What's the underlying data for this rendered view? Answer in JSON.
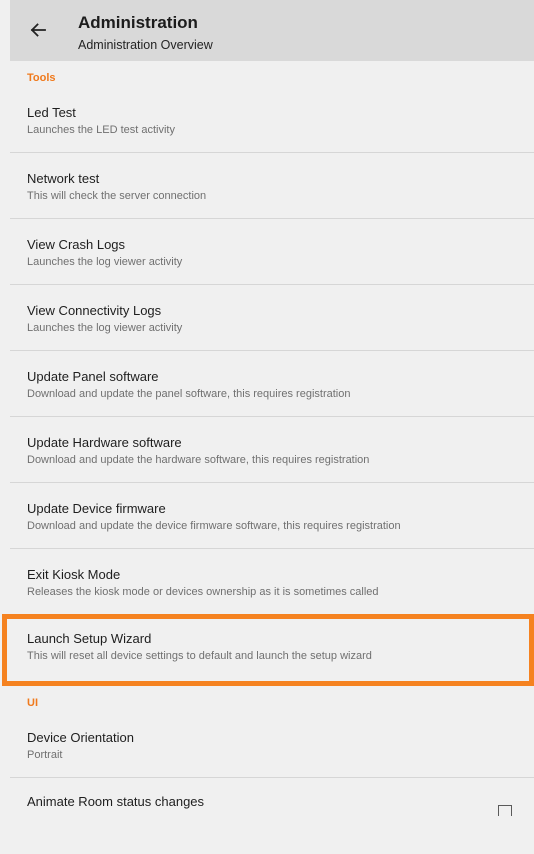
{
  "appbar": {
    "title": "Administration",
    "subtitle": "Administration Overview",
    "back_icon": "arrow-left-icon"
  },
  "categories": {
    "tools": "Tools",
    "ui": "UI"
  },
  "tools": [
    {
      "title": "Led Test",
      "summary": "Launches the LED test activity"
    },
    {
      "title": "Network test",
      "summary": "This will check the server connection"
    },
    {
      "title": "View Crash Logs",
      "summary": "Launches the log viewer activity"
    },
    {
      "title": "View Connectivity Logs",
      "summary": "Launches the log viewer activity"
    },
    {
      "title": "Update Panel software",
      "summary": "Download and update the panel software, this requires registration"
    },
    {
      "title": "Update Hardware software",
      "summary": "Download and update the hardware software, this requires registration"
    },
    {
      "title": "Update Device firmware",
      "summary": "Download and update the device firmware software, this requires registration"
    },
    {
      "title": "Exit Kiosk Mode",
      "summary": "Releases the kiosk mode or devices ownership as it is sometimes called"
    },
    {
      "title": "Launch Setup Wizard",
      "summary": "This will reset all device settings to default and launch the setup wizard"
    }
  ],
  "ui": [
    {
      "title": "Device Orientation",
      "summary": "Portrait"
    },
    {
      "title": "Animate Room status changes",
      "checked": false
    }
  ],
  "colors": {
    "accent": "#f07a1d",
    "highlight": "#f58220",
    "appbar": "#d9d9d9",
    "background": "#f0f0f0"
  }
}
